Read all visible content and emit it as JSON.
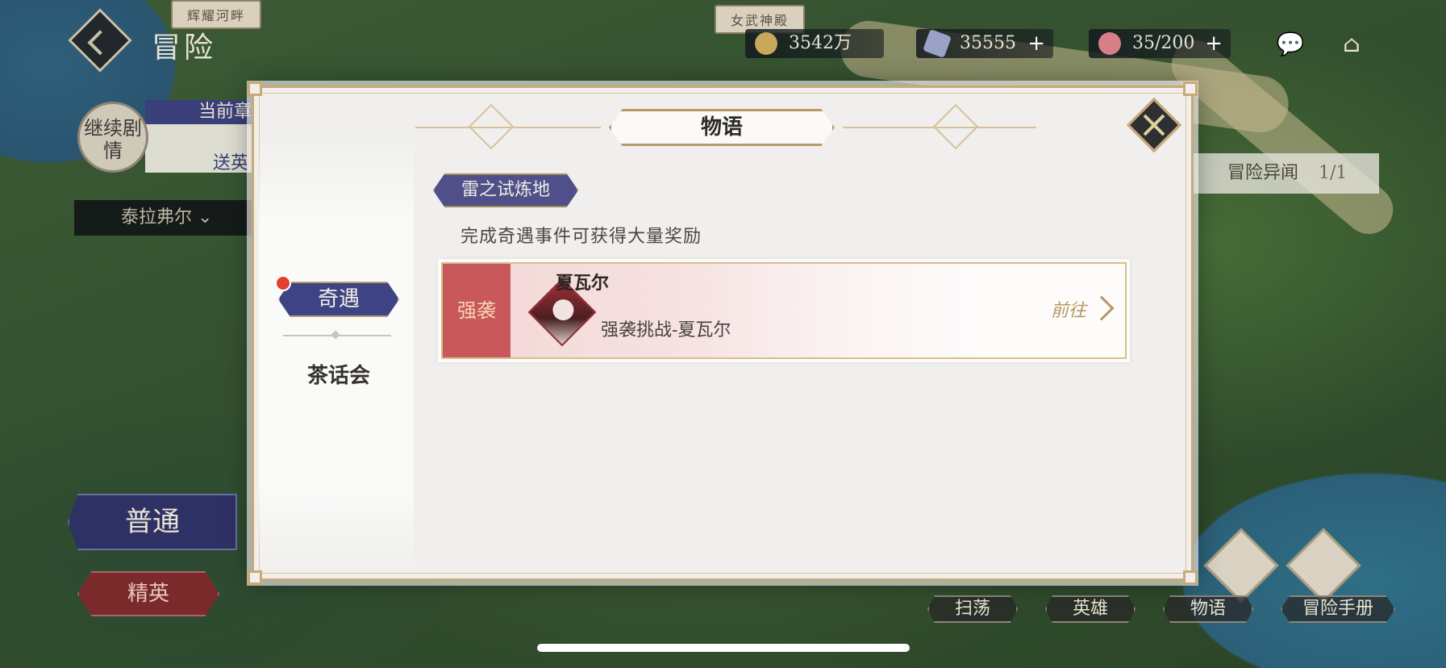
{
  "map": {
    "sign_riverside": "辉耀河畔",
    "sign_temple": "女武神殿",
    "mode_title": "冒险",
    "resources": [
      {
        "name": "gold",
        "value": "3542万",
        "icon": "gold-coin-icon",
        "has_plus": false
      },
      {
        "name": "diamond",
        "value": "35555",
        "icon": "diamond-icon",
        "has_plus": true
      },
      {
        "name": "stamina",
        "value": "35/200",
        "icon": "cake-icon",
        "has_plus": true
      }
    ],
    "continue_story": "继续剧情",
    "chapter_head": "当前章",
    "chapter_name": "送英",
    "region": "泰拉弗尔",
    "difficulty_normal": "普通",
    "difficulty_elite": "精英",
    "side_quest": "冒险异闻",
    "side_quest_count": "1/1",
    "nav": [
      "扫荡",
      "英雄",
      "物语",
      "冒险手册"
    ]
  },
  "modal": {
    "title": "物语",
    "tabs": {
      "active": "奇遇",
      "second": "茶话会"
    },
    "area_label": "雷之试炼地",
    "description": "完成奇遇事件可获得大量奖励",
    "event": {
      "tag": "强袭",
      "name": "夏瓦尔",
      "subtitle": "强袭挑战-夏瓦尔",
      "go_label": "前往"
    }
  },
  "colors": {
    "accent_gold": "#c9aa74",
    "tab_active_bg": "#3d4385",
    "event_tag_bg": "#c8585c",
    "notification_dot": "#e2402e"
  }
}
